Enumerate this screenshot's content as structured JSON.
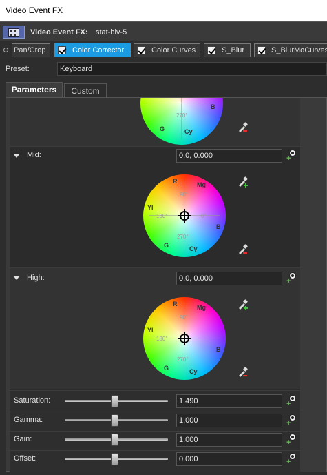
{
  "window": {
    "title": "Video Event FX"
  },
  "header": {
    "label": "Video Event FX:",
    "event_name": "stat-biv-5"
  },
  "chain": [
    {
      "label": "Pan/Crop",
      "checked": false,
      "active": false
    },
    {
      "label": "Color Corrector",
      "checked": true,
      "active": true
    },
    {
      "label": "Color Curves",
      "checked": true,
      "active": false
    },
    {
      "label": "S_Blur",
      "checked": true,
      "active": false
    },
    {
      "label": "S_BlurMoCurves",
      "checked": true,
      "active": false
    }
  ],
  "preset": {
    "label": "Preset:",
    "value": "Keyboard"
  },
  "tabs": {
    "parameters": "Parameters",
    "custom": "Custom"
  },
  "wheel_labels": {
    "r": "R",
    "mg": "Mg",
    "b": "B",
    "cy": "Cy",
    "g": "G",
    "yl": "Yl",
    "deg0": "0°",
    "deg90": "90°",
    "deg180": "180°",
    "deg270": "270°"
  },
  "sections": {
    "mid": {
      "label": "Mid:",
      "value": "0.0, 0.000"
    },
    "high": {
      "label": "High:",
      "value": "0.0, 0.000"
    }
  },
  "sliders": [
    {
      "label": "Saturation:",
      "value": "1.490"
    },
    {
      "label": "Gamma:",
      "value": "1.000"
    },
    {
      "label": "Gain:",
      "value": "1.000"
    },
    {
      "label": "Offset:",
      "value": "0.000"
    }
  ],
  "icons": {
    "plugin": "film-plugin-icon",
    "eyedropper_add": "eyedropper-plus-icon",
    "eyedropper_remove": "eyedropper-minus-icon",
    "keyframe": "keyframe-animate-icon",
    "collapse": "triangle-down-icon"
  },
  "colors": {
    "accent": "#1a9be2",
    "keyframe_green": "#5ec34a"
  }
}
